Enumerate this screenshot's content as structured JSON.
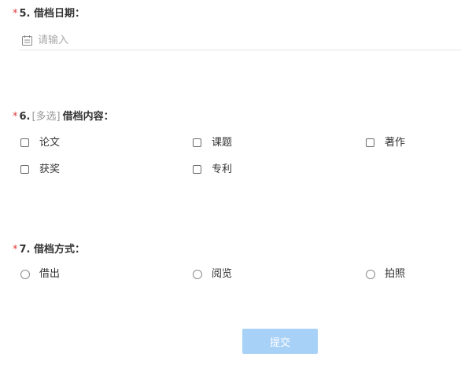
{
  "q5": {
    "required_mark": "*",
    "number": "5.",
    "title": "借档日期：",
    "placeholder": "请输入",
    "icon": "calendar-icon"
  },
  "q6": {
    "required_mark": "*",
    "number": "6.",
    "tag": "[多选]",
    "title": "借档内容：",
    "options": [
      "论文",
      "课题",
      "著作",
      "获奖",
      "专利"
    ]
  },
  "q7": {
    "required_mark": "*",
    "number": "7.",
    "title": "借档方式：",
    "options": [
      "借出",
      "阅览",
      "拍照"
    ]
  },
  "submit": {
    "label": "提交"
  },
  "colors": {
    "required": "#e4393c",
    "submit_bg": "#a8d1f7",
    "text": "#333333",
    "muted": "#999999"
  }
}
